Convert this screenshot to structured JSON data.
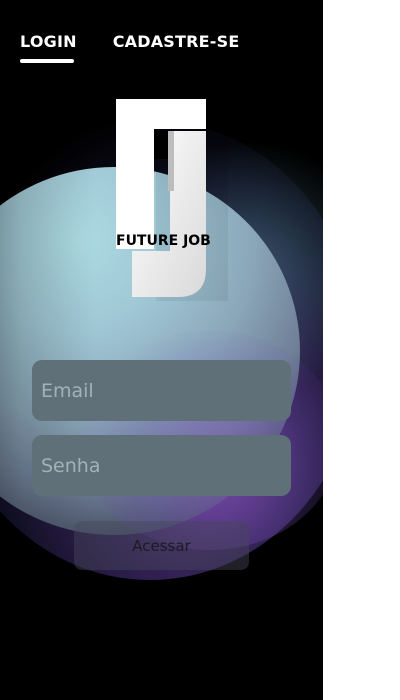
{
  "nav": {
    "tabs": [
      {
        "label": "LOGIN",
        "active": true
      },
      {
        "label": "CADASTRE-SE",
        "active": false
      }
    ]
  },
  "logo": {
    "monogram": "FJ",
    "text": "FUTURE JOB"
  },
  "form": {
    "email_placeholder": "Email",
    "password_placeholder": "Senha",
    "submit_label": "Acessar"
  },
  "colors": {
    "background": "#000000",
    "circle_top": "#acdbe3",
    "input_fill": "#5f7078",
    "accent_glow": "#8c5ac8"
  }
}
